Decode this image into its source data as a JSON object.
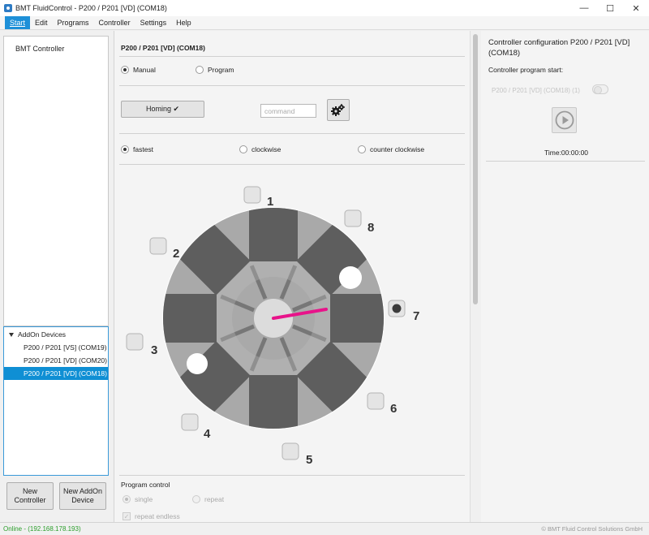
{
  "window": {
    "title": "BMT FluidControl  - P200 / P201 [VD] (COM18)",
    "minimize": "—",
    "maximize": "☐",
    "close": "✕"
  },
  "menu": [
    "Start",
    "Edit",
    "Programs",
    "Controller",
    "Settings",
    "Help"
  ],
  "left": {
    "controller_node": "BMT Controller",
    "addon_group": "AddOn Devices",
    "addon_devices": [
      {
        "label": "P200 / P201 [VS] (COM19)",
        "selected": false
      },
      {
        "label": "P200 / P201 [VD] (COM20)",
        "selected": false
      },
      {
        "label": "P200 / P201 [VD] (COM18)",
        "selected": true
      }
    ],
    "new_controller": "New Controller",
    "new_addon": "New AddOn Device"
  },
  "center": {
    "title": "P200 / P201 [VD] (COM18)",
    "mode_manual": "Manual",
    "mode_program": "Program",
    "mode_selected": "Manual",
    "homing_button": "Homing ✔",
    "command_placeholder": "command",
    "dir_fastest": "fastest",
    "dir_clockwise": "clockwise",
    "dir_counter": "counter clockwise",
    "direction_selected": "fastest",
    "ports": [
      "1",
      "2",
      "3",
      "4",
      "5",
      "6",
      "7",
      "8"
    ],
    "active_port": "7",
    "program_control": "Program control",
    "single": "single",
    "repeat": "repeat",
    "repeat_endless": "repeat endless"
  },
  "right": {
    "title": "Controller configuration P200 / P201 [VD] (COM18)",
    "program_start": "Controller program start:",
    "device_label": "P200 / P201 [VD] (COM18) (1)",
    "time": "Time:00:00:00"
  },
  "status": {
    "left": "Online - (192.168.178.193)",
    "right": "© BMT Fluid Control Solutions GmbH"
  },
  "colors": {
    "accent": "#1e90d8",
    "selected_row": "#0f8fd4",
    "pointer": "#e8138a",
    "online": "#2b9e2b"
  },
  "icons": [
    "app-icon",
    "gear-icon",
    "play-icon",
    "caret-down-icon",
    "check-icon"
  ]
}
